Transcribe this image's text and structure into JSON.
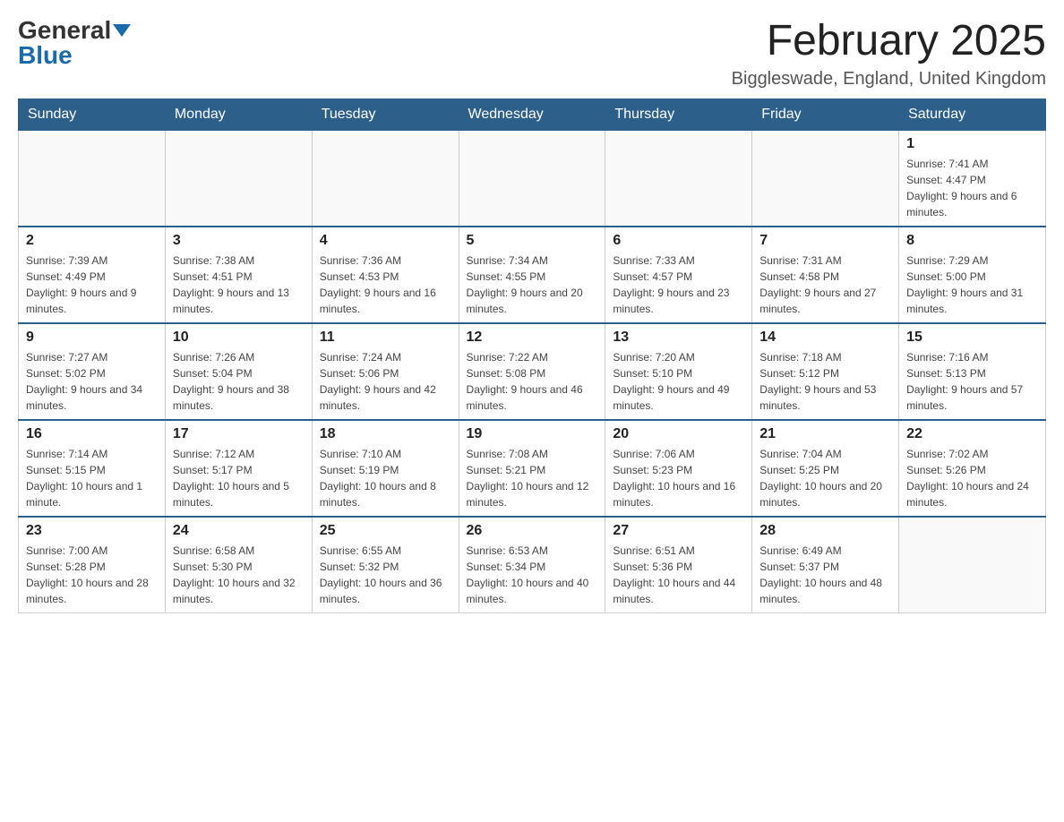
{
  "logo": {
    "general": "General",
    "blue": "Blue"
  },
  "title": "February 2025",
  "location": "Biggleswade, England, United Kingdom",
  "days_of_week": [
    "Sunday",
    "Monday",
    "Tuesday",
    "Wednesday",
    "Thursday",
    "Friday",
    "Saturday"
  ],
  "weeks": [
    [
      {
        "day": "",
        "info": ""
      },
      {
        "day": "",
        "info": ""
      },
      {
        "day": "",
        "info": ""
      },
      {
        "day": "",
        "info": ""
      },
      {
        "day": "",
        "info": ""
      },
      {
        "day": "",
        "info": ""
      },
      {
        "day": "1",
        "info": "Sunrise: 7:41 AM\nSunset: 4:47 PM\nDaylight: 9 hours and 6 minutes."
      }
    ],
    [
      {
        "day": "2",
        "info": "Sunrise: 7:39 AM\nSunset: 4:49 PM\nDaylight: 9 hours and 9 minutes."
      },
      {
        "day": "3",
        "info": "Sunrise: 7:38 AM\nSunset: 4:51 PM\nDaylight: 9 hours and 13 minutes."
      },
      {
        "day": "4",
        "info": "Sunrise: 7:36 AM\nSunset: 4:53 PM\nDaylight: 9 hours and 16 minutes."
      },
      {
        "day": "5",
        "info": "Sunrise: 7:34 AM\nSunset: 4:55 PM\nDaylight: 9 hours and 20 minutes."
      },
      {
        "day": "6",
        "info": "Sunrise: 7:33 AM\nSunset: 4:57 PM\nDaylight: 9 hours and 23 minutes."
      },
      {
        "day": "7",
        "info": "Sunrise: 7:31 AM\nSunset: 4:58 PM\nDaylight: 9 hours and 27 minutes."
      },
      {
        "day": "8",
        "info": "Sunrise: 7:29 AM\nSunset: 5:00 PM\nDaylight: 9 hours and 31 minutes."
      }
    ],
    [
      {
        "day": "9",
        "info": "Sunrise: 7:27 AM\nSunset: 5:02 PM\nDaylight: 9 hours and 34 minutes."
      },
      {
        "day": "10",
        "info": "Sunrise: 7:26 AM\nSunset: 5:04 PM\nDaylight: 9 hours and 38 minutes."
      },
      {
        "day": "11",
        "info": "Sunrise: 7:24 AM\nSunset: 5:06 PM\nDaylight: 9 hours and 42 minutes."
      },
      {
        "day": "12",
        "info": "Sunrise: 7:22 AM\nSunset: 5:08 PM\nDaylight: 9 hours and 46 minutes."
      },
      {
        "day": "13",
        "info": "Sunrise: 7:20 AM\nSunset: 5:10 PM\nDaylight: 9 hours and 49 minutes."
      },
      {
        "day": "14",
        "info": "Sunrise: 7:18 AM\nSunset: 5:12 PM\nDaylight: 9 hours and 53 minutes."
      },
      {
        "day": "15",
        "info": "Sunrise: 7:16 AM\nSunset: 5:13 PM\nDaylight: 9 hours and 57 minutes."
      }
    ],
    [
      {
        "day": "16",
        "info": "Sunrise: 7:14 AM\nSunset: 5:15 PM\nDaylight: 10 hours and 1 minute."
      },
      {
        "day": "17",
        "info": "Sunrise: 7:12 AM\nSunset: 5:17 PM\nDaylight: 10 hours and 5 minutes."
      },
      {
        "day": "18",
        "info": "Sunrise: 7:10 AM\nSunset: 5:19 PM\nDaylight: 10 hours and 8 minutes."
      },
      {
        "day": "19",
        "info": "Sunrise: 7:08 AM\nSunset: 5:21 PM\nDaylight: 10 hours and 12 minutes."
      },
      {
        "day": "20",
        "info": "Sunrise: 7:06 AM\nSunset: 5:23 PM\nDaylight: 10 hours and 16 minutes."
      },
      {
        "day": "21",
        "info": "Sunrise: 7:04 AM\nSunset: 5:25 PM\nDaylight: 10 hours and 20 minutes."
      },
      {
        "day": "22",
        "info": "Sunrise: 7:02 AM\nSunset: 5:26 PM\nDaylight: 10 hours and 24 minutes."
      }
    ],
    [
      {
        "day": "23",
        "info": "Sunrise: 7:00 AM\nSunset: 5:28 PM\nDaylight: 10 hours and 28 minutes."
      },
      {
        "day": "24",
        "info": "Sunrise: 6:58 AM\nSunset: 5:30 PM\nDaylight: 10 hours and 32 minutes."
      },
      {
        "day": "25",
        "info": "Sunrise: 6:55 AM\nSunset: 5:32 PM\nDaylight: 10 hours and 36 minutes."
      },
      {
        "day": "26",
        "info": "Sunrise: 6:53 AM\nSunset: 5:34 PM\nDaylight: 10 hours and 40 minutes."
      },
      {
        "day": "27",
        "info": "Sunrise: 6:51 AM\nSunset: 5:36 PM\nDaylight: 10 hours and 44 minutes."
      },
      {
        "day": "28",
        "info": "Sunrise: 6:49 AM\nSunset: 5:37 PM\nDaylight: 10 hours and 48 minutes."
      },
      {
        "day": "",
        "info": ""
      }
    ]
  ]
}
